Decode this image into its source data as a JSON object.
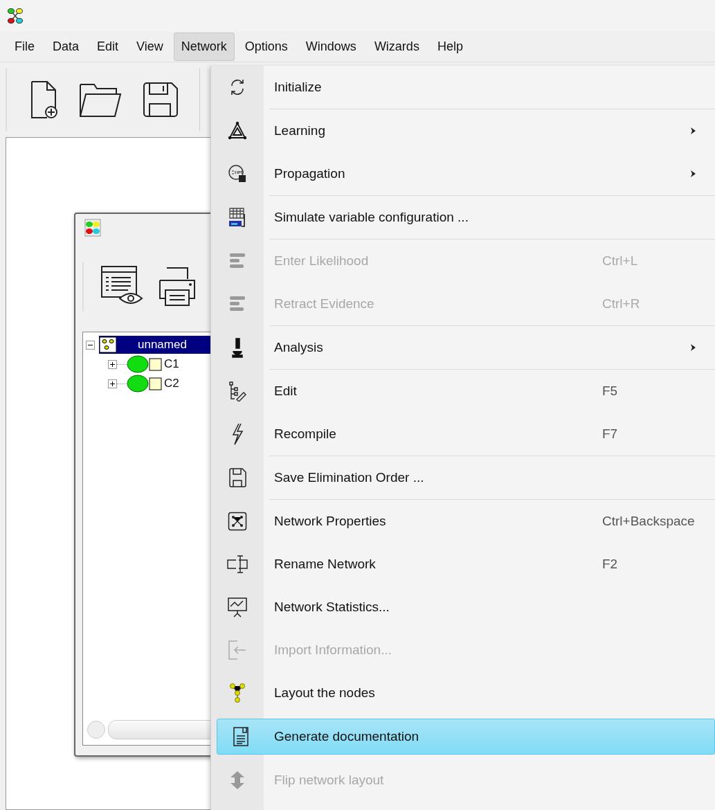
{
  "menu_bar": [
    {
      "label": "File",
      "selected": false
    },
    {
      "label": "Data",
      "selected": false
    },
    {
      "label": "Edit",
      "selected": false
    },
    {
      "label": "View",
      "selected": false
    },
    {
      "label": "Network",
      "selected": true
    },
    {
      "label": "Options",
      "selected": false
    },
    {
      "label": "Windows",
      "selected": false
    },
    {
      "label": "Wizards",
      "selected": false
    },
    {
      "label": "Help",
      "selected": false
    }
  ],
  "network_menu": [
    {
      "label": "Initialize",
      "kind": "action",
      "disabled": false,
      "selected": false,
      "separator_after": true
    },
    {
      "label": "Learning",
      "kind": "submenu",
      "disabled": false,
      "selected": false,
      "separator_after": false
    },
    {
      "label": "Propagation",
      "kind": "submenu",
      "disabled": false,
      "selected": false,
      "separator_after": true
    },
    {
      "label": "Simulate variable configuration ...",
      "kind": "action",
      "disabled": false,
      "selected": false,
      "separator_after": true
    },
    {
      "label": "Enter Likelihood",
      "kind": "action",
      "disabled": true,
      "selected": false,
      "shortcut": "Ctrl+L",
      "separator_after": false
    },
    {
      "label": "Retract Evidence",
      "kind": "action",
      "disabled": true,
      "selected": false,
      "shortcut": "Ctrl+R",
      "separator_after": true
    },
    {
      "label": "Analysis",
      "kind": "submenu",
      "disabled": false,
      "selected": false,
      "separator_after": true
    },
    {
      "label": "Edit",
      "kind": "action",
      "disabled": false,
      "selected": false,
      "shortcut": "F5",
      "separator_after": false
    },
    {
      "label": "Recompile",
      "kind": "action",
      "disabled": false,
      "selected": false,
      "shortcut": "F7",
      "separator_after": true
    },
    {
      "label": "Save Elimination Order ...",
      "kind": "action",
      "disabled": false,
      "selected": false,
      "separator_after": true
    },
    {
      "label": "Network Properties",
      "kind": "action",
      "disabled": false,
      "selected": false,
      "shortcut": "Ctrl+Backspace",
      "separator_after": false
    },
    {
      "label": "Rename Network",
      "kind": "action",
      "disabled": false,
      "selected": false,
      "shortcut": "F2",
      "separator_after": false
    },
    {
      "label": "Network Statistics...",
      "kind": "action",
      "disabled": false,
      "selected": false,
      "separator_after": false
    },
    {
      "label": "Import Information...",
      "kind": "action",
      "disabled": true,
      "selected": false,
      "separator_after": false
    },
    {
      "label": "Layout the nodes",
      "kind": "action",
      "disabled": false,
      "selected": false,
      "separator_after": false
    },
    {
      "label": "Generate documentation",
      "kind": "action",
      "disabled": false,
      "selected": true,
      "separator_after": false
    },
    {
      "label": "Flip network layout",
      "kind": "action",
      "disabled": true,
      "selected": false,
      "separator_after": false
    }
  ],
  "network_window": {
    "tree": {
      "label": "unnamed",
      "selected": true,
      "expanded": true,
      "children": [
        {
          "label": "C1",
          "expanded": false
        },
        {
          "label": "C2",
          "expanded": false
        }
      ]
    }
  }
}
